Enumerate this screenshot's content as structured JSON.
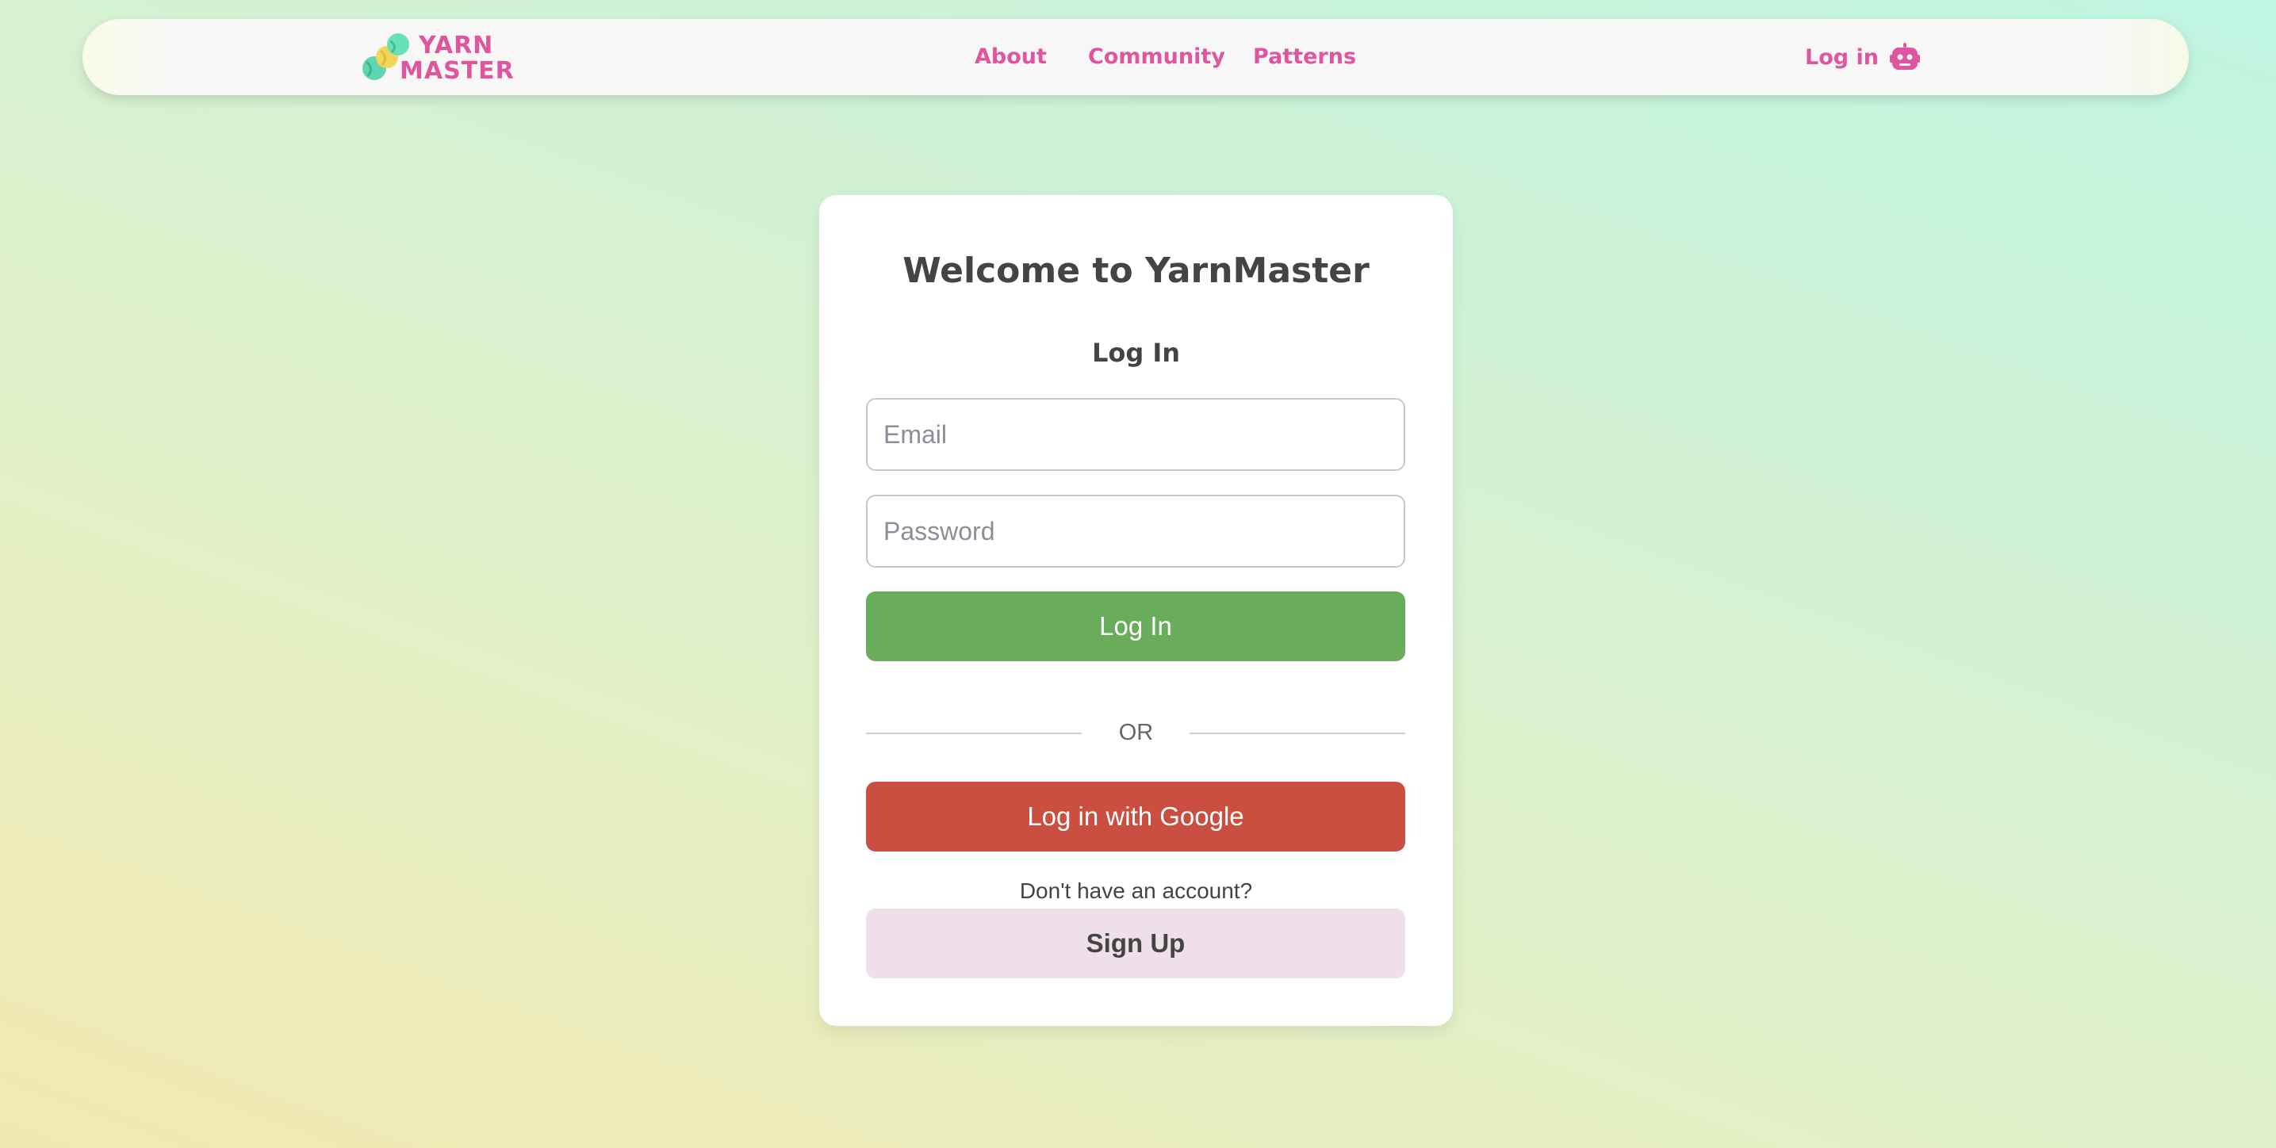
{
  "nav": {
    "logo": {
      "line1": "YARN",
      "line2": "MASTER"
    },
    "links": [
      {
        "label": "About"
      },
      {
        "label": "Community"
      },
      {
        "label": "Patterns"
      }
    ],
    "login_label": "Log in",
    "login_icon": "robot-icon"
  },
  "card": {
    "title": "Welcome to YarnMaster",
    "subtitle": "Log In",
    "email_placeholder": "Email",
    "password_placeholder": "Password",
    "login_button": "Log In",
    "or_text": "OR",
    "google_button": "Log in with Google",
    "no_account_text": "Don't have an account?",
    "signup_button": "Sign Up"
  },
  "colors": {
    "brand_pink": "#e0559f",
    "login_green": "#69ad5c",
    "google_red": "#cb4f40",
    "signup_pink": "#efdfe8"
  }
}
